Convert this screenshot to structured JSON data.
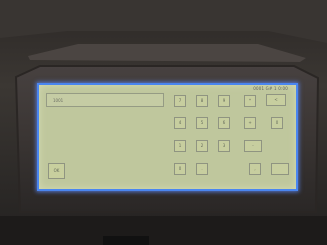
{
  "screen": {
    "status_text": "0001 G# 1 0:00",
    "input": {
      "value": "1001"
    },
    "keypad": {
      "row1": [
        "7",
        "8",
        "9",
        "*",
        "<"
      ],
      "row2": [
        "4",
        "5",
        "6",
        "+",
        "0"
      ],
      "row3": [
        "1",
        "2",
        "3",
        "-"
      ],
      "row4": [
        "0",
        ".",
        ",",
        ""
      ]
    },
    "ok_label": "OK"
  }
}
